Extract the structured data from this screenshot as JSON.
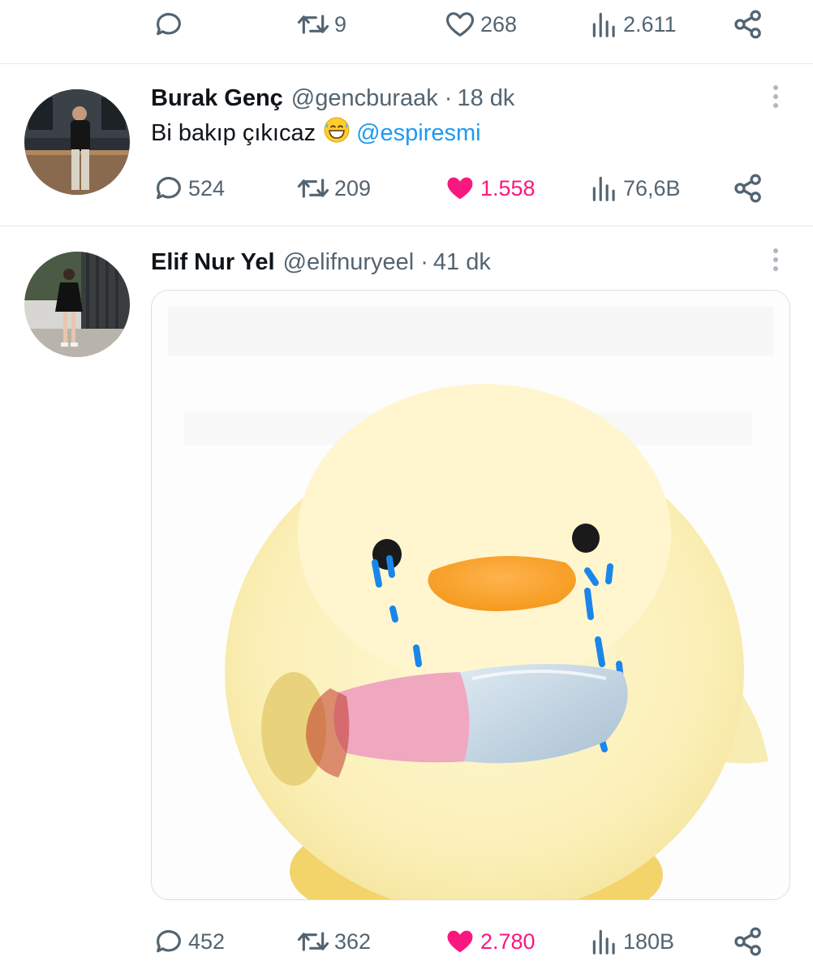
{
  "top_actions": {
    "reply": "",
    "retweets": "9",
    "likes": "268",
    "views": "2.611"
  },
  "tweets": [
    {
      "name": "Burak Genç",
      "handle": "@gencburaak",
      "separator": "·",
      "time": "18 dk",
      "text": "Bi bakıp çıkıcaz",
      "emoji": "grinning-sweat-emoji",
      "mention": "@espiresmi",
      "replies": "524",
      "retweets": "209",
      "likes": "1.558",
      "views": "76,6B",
      "liked": true
    },
    {
      "name": "Elif Nur Yel",
      "handle": "@elifnuryeel",
      "separator": "·",
      "time": "41 dk",
      "media": "crying-duckling-with-knife-image",
      "replies": "452",
      "retweets": "362",
      "likes": "2.780",
      "views": "180B",
      "liked": true
    }
  ],
  "icons": {
    "reply": "speech-bubble-icon",
    "retweet": "retweet-icon",
    "like": "heart-icon",
    "views": "bar-chart-icon",
    "share": "share-icon",
    "more": "vertical-dots-icon"
  },
  "colors": {
    "like": "#f91880",
    "mention": "#1d9bf0",
    "muted": "#536471",
    "text": "#0f1419"
  }
}
